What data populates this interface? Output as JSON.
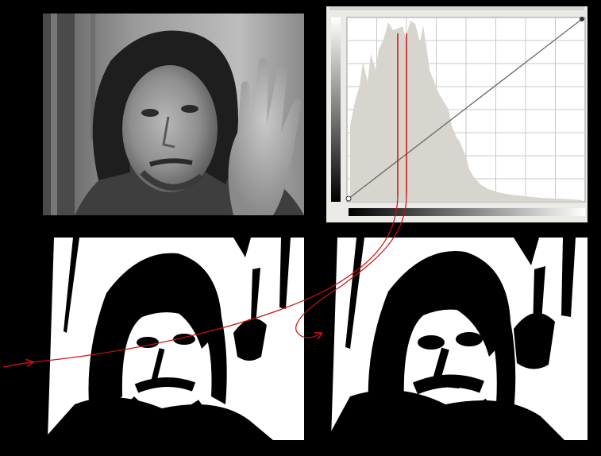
{
  "colors": {
    "background": "#000000",
    "curve_panel": "#eceae6",
    "histogram": "#d8d4ce",
    "grid": "#c8c8c8",
    "curve_line": "#6e6e6e",
    "marker_lines": "#cc1111",
    "arrows": "#cc1111",
    "threshold_white": "#ffffff",
    "threshold_black": "#000000"
  },
  "panels": [
    {
      "key": "photo",
      "kind": "grayscale-portrait-photo"
    },
    {
      "key": "curves",
      "kind": "curves-histogram-editor"
    },
    {
      "key": "thr-low",
      "kind": "binary-threshold-result"
    },
    {
      "key": "thr-high",
      "kind": "binary-threshold-result"
    }
  ],
  "curves_editor": {
    "curve": "linear-identity",
    "grid_divisions": 8,
    "threshold_markers": 2
  },
  "icons": [
    "curve-endpoint-handle-icon",
    "arrow-head-icon"
  ]
}
